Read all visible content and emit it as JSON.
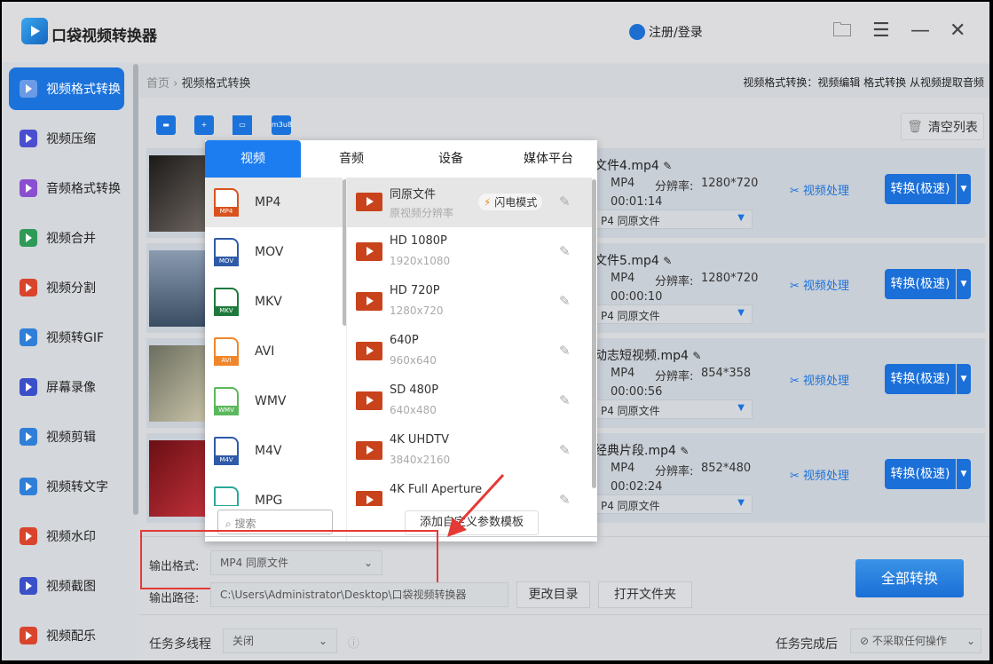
{
  "app": {
    "title": "口袋视频转换器",
    "login": "注册/登录"
  },
  "sidebar": {
    "items": [
      {
        "label": "视频格式转换"
      },
      {
        "label": "视频压缩"
      },
      {
        "label": "音频格式转换"
      },
      {
        "label": "视频合并"
      },
      {
        "label": "视频分割"
      },
      {
        "label": "视频转GIF"
      },
      {
        "label": "屏幕录像"
      },
      {
        "label": "视频剪辑"
      },
      {
        "label": "视频转文字"
      },
      {
        "label": "视频水印"
      },
      {
        "label": "视频截图"
      },
      {
        "label": "视频配乐"
      }
    ]
  },
  "breadcrumb": {
    "home": "首页",
    "sep": "›",
    "current": "视频格式转换",
    "description": "视频格式转换：视频编辑 格式转换 从视频提取音频"
  },
  "toolbar": {
    "m3u8": "m3u8",
    "clear": "清空列表"
  },
  "files": [
    {
      "name": "文件4.mp4",
      "format": "MP4",
      "res_label": "分辨率:",
      "res": "1280*720",
      "duration": "00:01:14",
      "output": "P4  同原文件"
    },
    {
      "name": "文件5.mp4",
      "format": "MP4",
      "res_label": "分辨率:",
      "res": "1280*720",
      "duration": "00:00:10",
      "output": "P4  同原文件"
    },
    {
      "name": "动志短视频.mp4",
      "format": "MP4",
      "res_label": "分辨率:",
      "res": "854*358",
      "duration": "00:00:56",
      "output": "P4  同原文件"
    },
    {
      "name": "经典片段.mp4",
      "format": "MP4",
      "res_label": "分辨率:",
      "res": "852*480",
      "duration": "00:02:24",
      "output": "P4  同原文件"
    }
  ],
  "file_actions": {
    "process": "视频处理",
    "convert": "转换(极速)"
  },
  "popup": {
    "tabs": [
      "视频",
      "音频",
      "设备",
      "媒体平台"
    ],
    "formats": [
      {
        "name": "MP4",
        "color": "#d9531e"
      },
      {
        "name": "MOV",
        "color": "#2f5aa8"
      },
      {
        "name": "MKV",
        "color": "#1e7a3c"
      },
      {
        "name": "AVI",
        "color": "#f0862a"
      },
      {
        "name": "WMV",
        "color": "#5cb85c"
      },
      {
        "name": "M4V",
        "color": "#2f5aa8"
      },
      {
        "name": "MPG",
        "color": "#2aa89a"
      }
    ],
    "presets": [
      {
        "name": "同原文件",
        "sub": "原视频分辨率"
      },
      {
        "name": "HD 1080P",
        "sub": "1920x1080"
      },
      {
        "name": "HD 720P",
        "sub": "1280x720"
      },
      {
        "name": "640P",
        "sub": "960x640"
      },
      {
        "name": "SD 480P",
        "sub": "640x480"
      },
      {
        "name": "4K UHDTV",
        "sub": "3840x2160"
      },
      {
        "name": "4K Full Aperture",
        "sub": ""
      }
    ],
    "flash": "闪电模式",
    "search_placeholder": "搜索",
    "add_template": "添加自定义参数模板"
  },
  "bottom": {
    "format_label": "输出格式:",
    "format_value": "MP4  同原文件",
    "path_label": "输出路径:",
    "path_value": "C:\\Users\\Administrator\\Desktop\\口袋视频转换器",
    "change_dir": "更改目录",
    "open_folder": "打开文件夹",
    "convert_all": "全部转换",
    "multithread_label": "任务多线程",
    "multithread_value": "关闭",
    "after_label": "任务完成后",
    "after_value": "不采取任何操作"
  }
}
